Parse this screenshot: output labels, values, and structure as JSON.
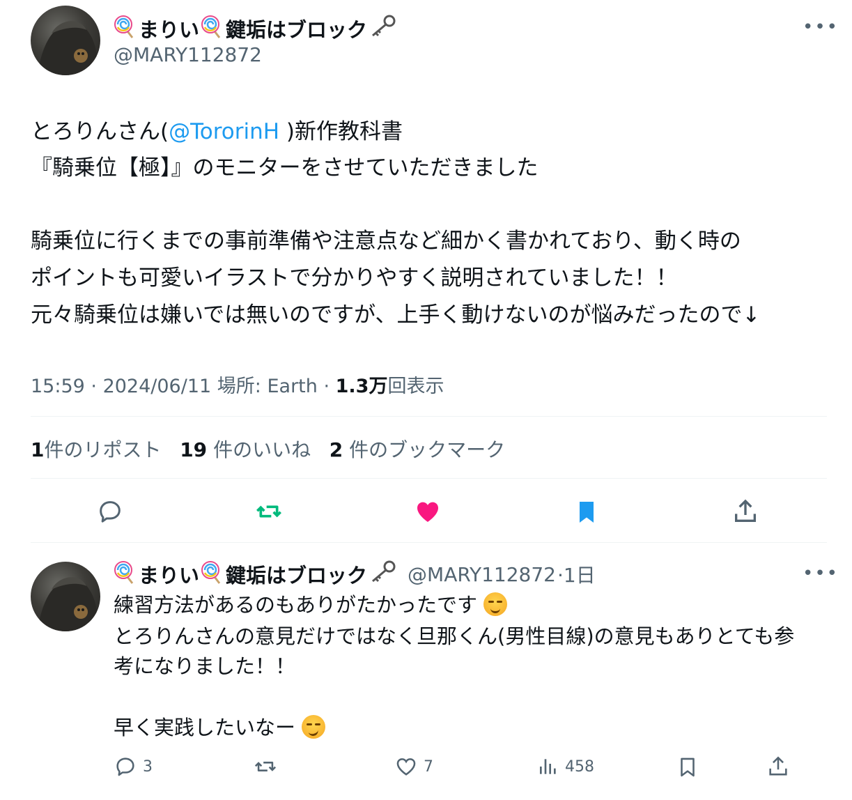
{
  "tweet": {
    "author": {
      "name_part1": "まりい",
      "name_part2": "鍵垢はブロック",
      "handle": "@MARY112872"
    },
    "more_label": "•••",
    "lines": {
      "l1_pre": "とろりんさん(",
      "l1_mention": "@TororinH",
      "l1_post": " )新作教科書",
      "l2": "『騎乗位【極】』のモニターをさせていただきました",
      "l3": "騎乗位に行くまでの事前準備や注意点など細かく書かれており、動く時の",
      "l4": "ポイントも可愛いイラストで分かりやすく説明されていました！！",
      "l5": "元々騎乗位は嫌いでは無いのですが、上手く動けないのが悩みだったので↓"
    },
    "meta": {
      "time": "15:59",
      "date": "2024/06/11",
      "location": "場所: Earth",
      "views_count": "1.3万",
      "views_label": "回表示",
      "sep": " · "
    },
    "stats": {
      "reposts_count": "1",
      "reposts_label": "件のリポスト",
      "likes_count": "19",
      "likes_label": " 件のいいね",
      "bookmarks_count": "2",
      "bookmarks_label": " 件のブックマーク"
    }
  },
  "reply": {
    "author": {
      "name_part1": "まりい",
      "name_part2": "鍵垢はブロック",
      "handle": "@MARY112872",
      "time": "·1日"
    },
    "more_label": "•••",
    "lines": {
      "l1": "練習方法があるのもありがたかったです",
      "l2": "とろりんさんの意見だけではなく旦那くん(男性目線)の意見もありとても参",
      "l3": "考になりました！！",
      "l4": "早く実践したいなー"
    },
    "actions": {
      "replies": "3",
      "likes": "7",
      "views": "458"
    }
  },
  "colors": {
    "accent": "#1d9bf0",
    "like_active": "#f91880",
    "repost_active": "#00ba7c",
    "bookmark_active": "#1d9bf0",
    "muted": "#536471"
  }
}
